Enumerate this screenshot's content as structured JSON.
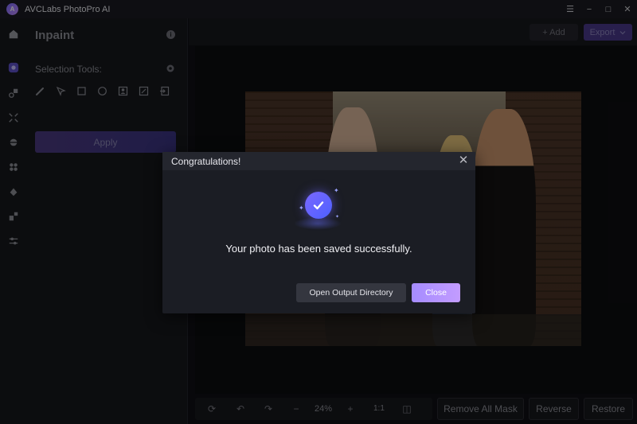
{
  "app": {
    "title": "AVCLabs PhotoPro AI",
    "logo_text": "A"
  },
  "window_controls": {
    "menu": "☰",
    "minimize": "−",
    "maximize": "□",
    "close": "✕"
  },
  "panel": {
    "title": "Inpaint",
    "selection_label": "Selection Tools:",
    "apply_label": "Apply"
  },
  "topbar": {
    "add_label": "+ Add",
    "export_label": "Export"
  },
  "bottombar": {
    "zoom": "24%",
    "one_to_one": "1:1",
    "remove_all_mask": "Remove All Mask",
    "reverse": "Reverse",
    "restore": "Restore"
  },
  "dialog": {
    "title": "Congratulations!",
    "message": "Your photo has been saved successfully.",
    "open_dir_label": "Open Output Directory",
    "close_label": "Close"
  },
  "colors": {
    "accent": "#7a67ff",
    "dialog_bg": "#1b1d24",
    "close_btn": "#b69aff"
  }
}
